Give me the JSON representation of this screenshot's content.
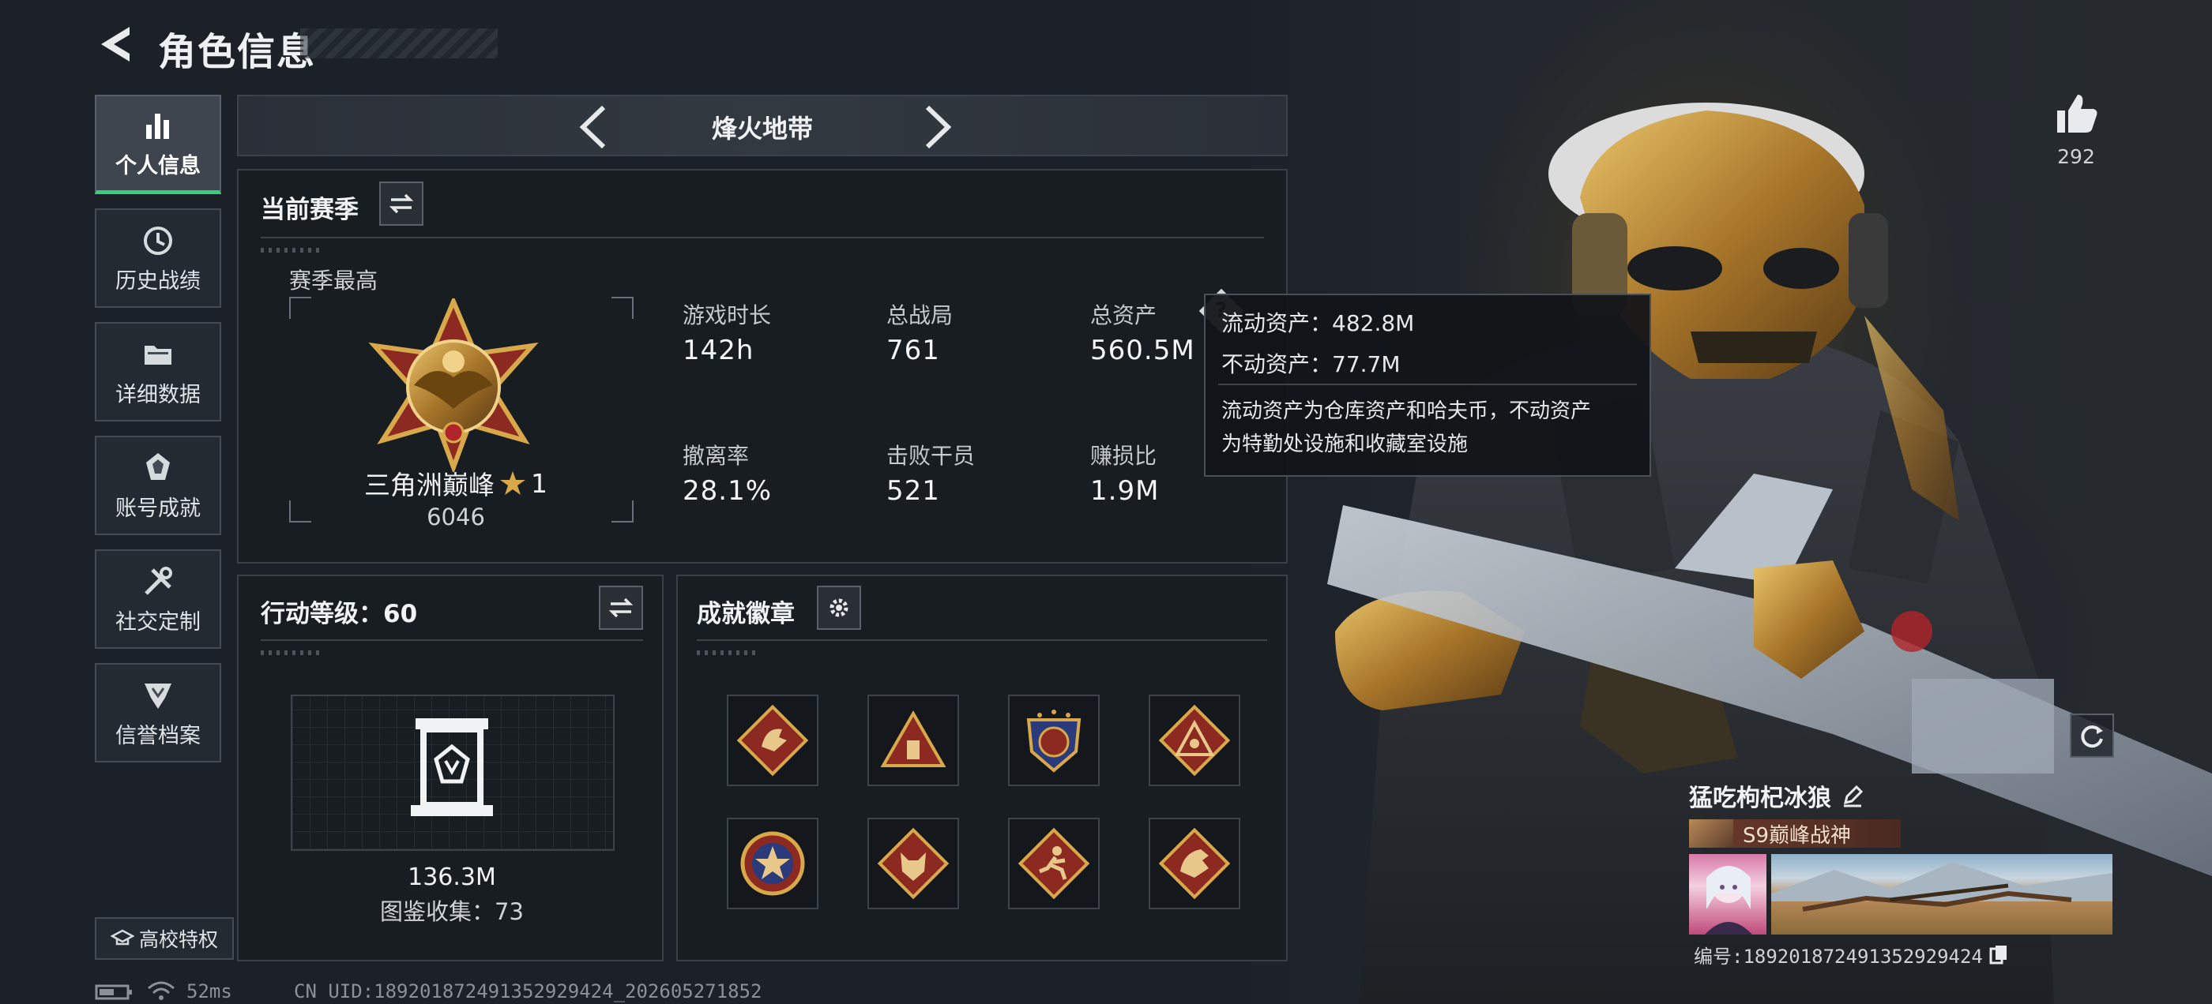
{
  "header": {
    "title": "角色信息"
  },
  "sidebar": {
    "items": [
      {
        "label": "个人信息",
        "icon": "bar-chart-icon",
        "active": true
      },
      {
        "label": "历史战绩",
        "icon": "history-clock-icon"
      },
      {
        "label": "详细数据",
        "icon": "folder-icon"
      },
      {
        "label": "账号成就",
        "icon": "trophy-icon"
      },
      {
        "label": "社交定制",
        "icon": "wrench-icon"
      },
      {
        "label": "信誉档案",
        "icon": "shield-rank-icon"
      }
    ],
    "campus_label": "高校特权"
  },
  "mode": {
    "name": "烽火地带"
  },
  "season": {
    "title": "当前赛季",
    "best_label": "赛季最高",
    "rank_name": "三角洲巅峰",
    "rank_stars": "1",
    "rank_points": "6046",
    "stats": [
      {
        "label": "游戏时长",
        "value": "142h"
      },
      {
        "label": "总战局",
        "value": "761"
      },
      {
        "label": "总资产",
        "value": "560.5M"
      },
      {
        "label": "撤离率",
        "value": "28.1%"
      },
      {
        "label": "击败干员",
        "value": "521"
      },
      {
        "label": "赚损比",
        "value": "1.9M"
      }
    ]
  },
  "tooltip": {
    "liquid": "流动资产：482.8M",
    "fixed": "不动资产：77.7M",
    "desc_line1": "流动资产为仓库资产和哈夫币，不动资产",
    "desc_line2": "为特勤处设施和收藏室设施"
  },
  "level": {
    "title": "行动等级：60",
    "value": "136.3M",
    "collection": "图鉴收集：73"
  },
  "achievements": {
    "title": "成就徽章",
    "badges": [
      "dragon-badge-icon",
      "pyramid-badge-icon",
      "crest-badge-icon",
      "triangle-eye-badge-icon",
      "star-medal-badge-icon",
      "wolf-badge-icon",
      "runner-badge-icon",
      "dragon-head-badge-icon"
    ]
  },
  "likes": {
    "count": "292"
  },
  "player": {
    "name": "猛吃枸杞冰狼",
    "title": "S9巅峰战神",
    "id_label": "编号:1892018724913529294​24"
  },
  "footer": {
    "ping": "52ms",
    "uid": "CN UID:1892018724913529294​24_202605271852"
  },
  "colors": {
    "accent_green": "#34d07a",
    "gold": "#d8a94a",
    "badge_red": "#8c2a22"
  }
}
